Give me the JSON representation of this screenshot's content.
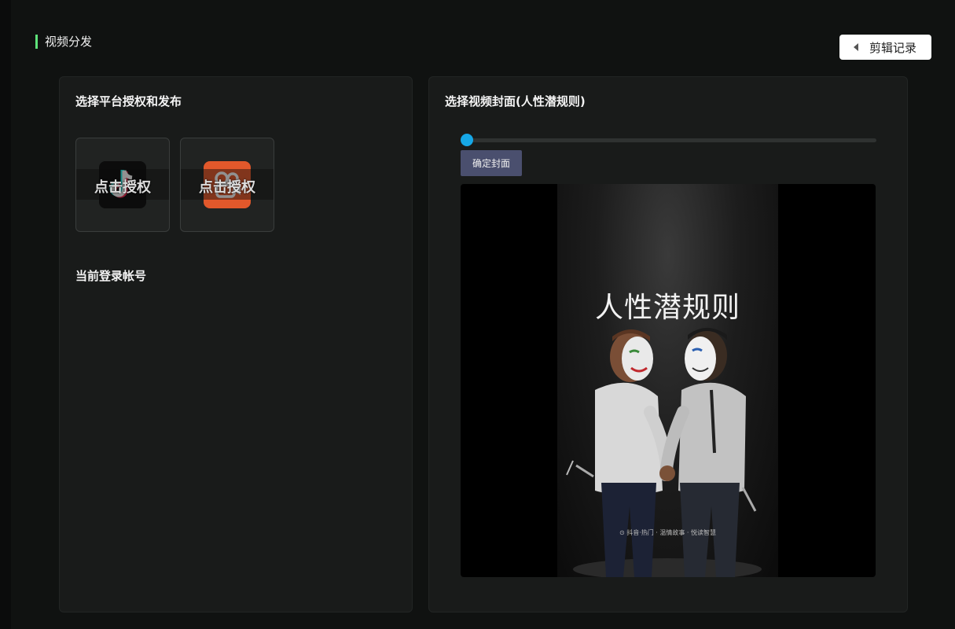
{
  "header": {
    "title": "视频分发",
    "back_button": "剪辑记录",
    "accent_color": "#5ee27a"
  },
  "left_panel": {
    "heading": "选择平台授权和发布",
    "platforms": [
      {
        "name": "douyin",
        "icon": "douyin-icon",
        "overlay": "点击授权"
      },
      {
        "name": "kuaishou",
        "icon": "kuaishou-icon",
        "overlay": "点击授权"
      }
    ],
    "account_heading": "当前登录帐号"
  },
  "right_panel": {
    "heading": "选择视频封面(人性潜规则)",
    "slider_value": 0,
    "confirm_button": "确定封面",
    "preview": {
      "poster_title": "人性潜规则",
      "poster_caption": "⊙ 抖音·热门 · 温情故事 · 悦读智慧"
    }
  },
  "colors": {
    "slider": "#16a7e6",
    "confirm_button": "#4a4f6e",
    "kuaishou": "#e2582b"
  }
}
